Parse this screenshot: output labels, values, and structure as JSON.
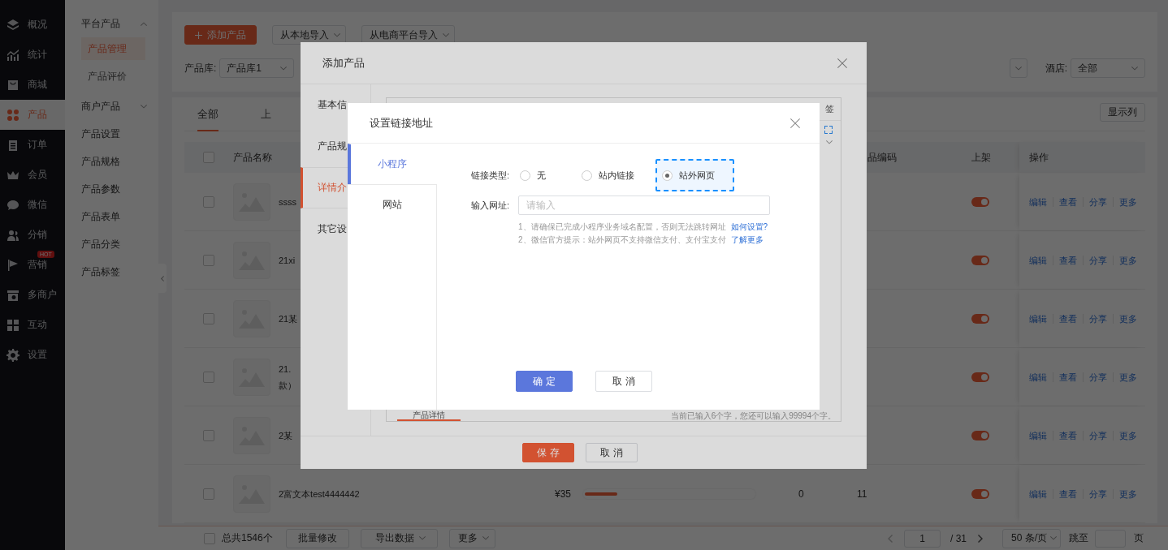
{
  "sidebar": {
    "items": [
      {
        "label": "概况",
        "selected": false
      },
      {
        "label": "统计",
        "selected": false
      },
      {
        "label": "商城",
        "selected": false
      },
      {
        "label": "产品",
        "selected": true
      },
      {
        "label": "订单",
        "selected": false
      },
      {
        "label": "会员",
        "selected": false
      },
      {
        "label": "微信",
        "selected": false
      },
      {
        "label": "分销",
        "selected": false
      },
      {
        "label": "营销",
        "selected": false,
        "badge": "HOT"
      },
      {
        "label": "多商户",
        "selected": false
      },
      {
        "label": "互动",
        "selected": false
      },
      {
        "label": "设置",
        "selected": false
      }
    ]
  },
  "subnav": {
    "items": [
      {
        "label": "平台产品",
        "selected": false,
        "expanded": true,
        "children": [
          {
            "label": "产品管理",
            "selected": true
          },
          {
            "label": "产品评价",
            "selected": false
          }
        ]
      },
      {
        "label": "商户产品",
        "selected": false,
        "expanded": false
      },
      {
        "label": "产品设置",
        "selected": false
      },
      {
        "label": "产品规格",
        "selected": false
      },
      {
        "label": "产品参数",
        "selected": false
      },
      {
        "label": "产品表单",
        "selected": false
      },
      {
        "label": "产品分类",
        "selected": false
      },
      {
        "label": "产品标签",
        "selected": false
      }
    ]
  },
  "toolbar": {
    "add_button": "添加产品",
    "import_local": "从本地导入",
    "import_platform": "从电商平台导入"
  },
  "filters": {
    "library_label": "产品库:",
    "library_value": "产品库1",
    "hotel_label": "酒店:",
    "hotel_value": "全部"
  },
  "tabs": [
    {
      "label": "全部",
      "selected": true
    },
    {
      "label": "上",
      "selected": false
    }
  ],
  "columns_button": "显示列",
  "table": {
    "select_all_checked": false,
    "columns": {
      "name": "产品名称",
      "code": "品编码",
      "on_shelf": "上架",
      "actions": "操作"
    },
    "rows": [
      {
        "checked": false,
        "name": [
          "ssss"
        ],
        "on_shelf": true,
        "actions": [
          "编辑",
          "查看",
          "分享",
          "更多"
        ]
      },
      {
        "checked": false,
        "name": [
          "21xi"
        ],
        "on_shelf": true,
        "actions": [
          "编辑",
          "查看",
          "分享",
          "更多"
        ]
      },
      {
        "checked": false,
        "name": [
          "21某"
        ],
        "on_shelf": true,
        "actions": [
          "编辑",
          "查看",
          "分享",
          "更多"
        ]
      },
      {
        "checked": false,
        "name": [
          "21.",
          "款）"
        ],
        "on_shelf": true,
        "actions": [
          "编辑",
          "查看",
          "分享",
          "更多"
        ]
      },
      {
        "checked": false,
        "name": [
          "2某"
        ],
        "on_shelf": true,
        "actions": [
          "编辑",
          "查看",
          "分享",
          "更多"
        ]
      },
      {
        "checked": false,
        "name": [
          "2富文本test4444442"
        ],
        "price": "¥35",
        "column_6": "0",
        "code": "11",
        "on_shelf": true,
        "actions": [
          "编辑",
          "查看",
          "分享",
          "更多"
        ]
      }
    ]
  },
  "footer": {
    "select_all_checked": false,
    "total": "总共1546个",
    "batch_button": "批量修改",
    "export": "导出数据",
    "more": "更多",
    "page": "1",
    "page_total": "/ 31",
    "page_size": "50 条/页",
    "jump_label": "跳至",
    "page_suffix": "页"
  },
  "add_dialog": {
    "title": "添加产品",
    "tabs": [
      {
        "label": "基本信",
        "selected": false
      },
      {
        "label": "产品规",
        "selected": false
      },
      {
        "label": "详情介",
        "selected": true
      },
      {
        "label": "其它设",
        "selected": false
      }
    ],
    "editor": {
      "tag_button": "签",
      "tab": "产品详情",
      "counter": "当前已输入6个字，您还可以输入99994个字。"
    },
    "buttons": [
      {
        "label": "保存",
        "kind": "primary"
      },
      {
        "label": "取消",
        "kind": "default"
      }
    ]
  },
  "link_dialog": {
    "title": "设置链接地址",
    "tabs": [
      {
        "label": "小程序",
        "selected": true
      },
      {
        "label": "网站",
        "selected": false
      }
    ],
    "link_type": {
      "label": "链接类型:",
      "options": [
        {
          "label": "无",
          "selected": false,
          "focused": false
        },
        {
          "label": "站内链接",
          "selected": false,
          "focused": false
        },
        {
          "label": "站外网页",
          "selected": true,
          "focused": true
        }
      ]
    },
    "url": {
      "label": "输入网址:",
      "placeholder": "请输入"
    },
    "notes": [
      {
        "text": "1、请确保已完成小程序业务域名配置，否则无法跳转网址",
        "link": "如何设置?"
      },
      {
        "text": "2、微信官方提示：站外网页不支持微信支付、支付宝支付",
        "link": "了解更多"
      }
    ],
    "buttons": [
      {
        "label": "确定",
        "kind": "primary"
      },
      {
        "label": "取消",
        "kind": "default"
      }
    ]
  }
}
